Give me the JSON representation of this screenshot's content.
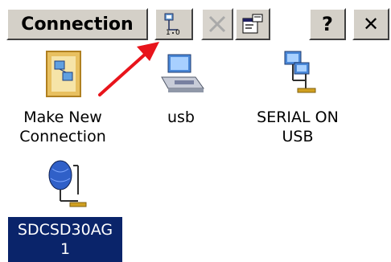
{
  "toolbar": {
    "title": "Connection",
    "help_label": "?",
    "close_label": "✕"
  },
  "icons": [
    {
      "label": "Make New\nConnection",
      "icon": "make-new-connection-icon"
    },
    {
      "label": "usb",
      "icon": "usb-computer-icon"
    },
    {
      "label": "SERIAL ON\nUSB",
      "icon": "network-computers-icon"
    },
    {
      "label": "SDCSD30AG\n1",
      "icon": "network-globe-icon",
      "selected": true
    }
  ],
  "annotation": {
    "arrow_color": "#e8141b"
  }
}
